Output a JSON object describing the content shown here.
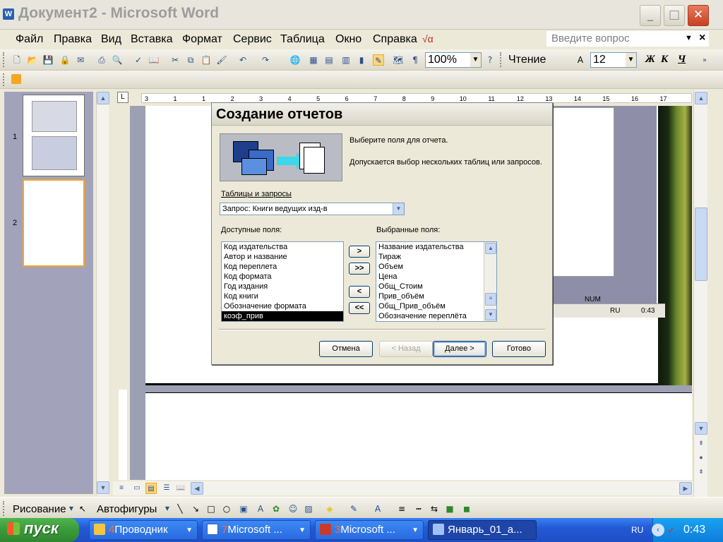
{
  "window": {
    "title": "Документ2 - Microsoft Word",
    "app_icon": "W",
    "controls": {
      "minimize": "_",
      "maximize": "□",
      "close": "✕"
    }
  },
  "menubar": {
    "items": [
      "Файл",
      "Правка",
      "Вид",
      "Вставка",
      "Формат",
      "Сервис",
      "Таблица",
      "Окно",
      "Справка"
    ],
    "ask_placeholder": "Введите вопрос",
    "doc_close": "×"
  },
  "toolbar": {
    "zoom": "100%",
    "read_label": "Чтение",
    "font_size": "12",
    "format_buttons": [
      "Ж",
      "К",
      "Ч"
    ]
  },
  "thumbnails": {
    "page_numbers": [
      "1",
      "2"
    ]
  },
  "ruler": {
    "labels": [
      "3",
      "1",
      "1",
      "2",
      "3",
      "4",
      "5",
      "6",
      "7",
      "8",
      "9",
      "10",
      "11",
      "12",
      "13",
      "14",
      "15",
      "16",
      "17"
    ]
  },
  "embedded": {
    "status_num": "NUM",
    "tray_lang": "RU",
    "tray_time": "0:43"
  },
  "dialog": {
    "title": "Создание отчетов",
    "intro_line1": "Выберите поля для отчета.",
    "intro_line2": "Допускается выбор нескольких таблиц или запросов.",
    "tables_label": "Таблицы и запросы",
    "tables_value": "Запрос: Книги ведущих изд-в",
    "available_label": "Доступные поля:",
    "selected_label": "Выбранные поля:",
    "available_fields": [
      "Код издательства",
      "Автор и название",
      "Код переплета",
      "Код формата",
      "Год издания",
      "Код книги",
      "Обозначение формата",
      "коэф_прив"
    ],
    "available_selected_index": 7,
    "selected_fields": [
      "Название издательства",
      "Тираж",
      "Объем",
      "Цена",
      "Общ_Стоим",
      "Прив_объём",
      "Общ_Прив_объём",
      "Обозначение переплёта"
    ],
    "move_buttons": [
      ">",
      ">>",
      "<",
      "<<"
    ],
    "buttons": {
      "cancel": "Отмена",
      "back": "< Назад",
      "next": "Далее >",
      "finish": "Готово"
    }
  },
  "drawbar": {
    "draw_label": "Рисование",
    "autoshapes_label": "Автофигуры"
  },
  "taskbar": {
    "start_label": "пуск",
    "tasks": [
      {
        "count": "4",
        "label": "Проводник"
      },
      {
        "count": "7",
        "label": "Microsoft ..."
      },
      {
        "count": "3",
        "label": "Microsoft ..."
      },
      {
        "count": "",
        "label": "Январь_01_а..."
      }
    ],
    "lang": "RU",
    "clock": "0:43"
  },
  "colors": {
    "accent": "#F5A623",
    "taskbar": "#235AD6",
    "start": "#3A9A3A"
  }
}
